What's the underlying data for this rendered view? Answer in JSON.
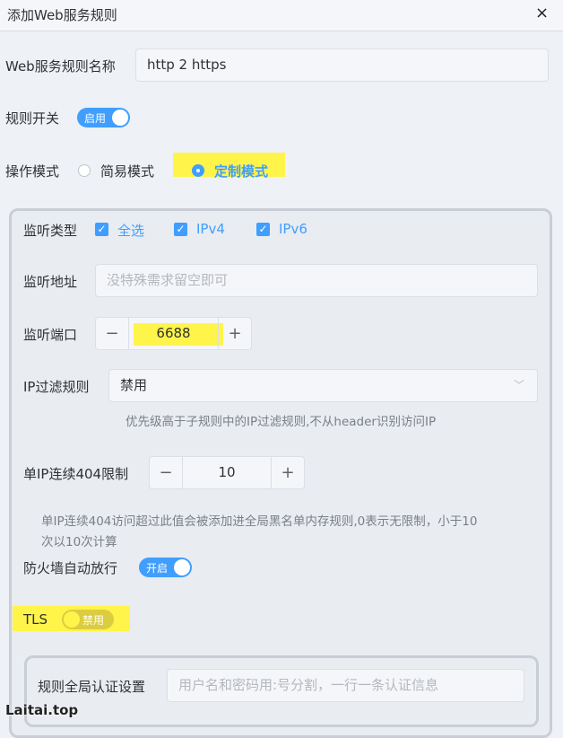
{
  "dialog": {
    "title": "添加Web服务规则",
    "close_icon": "×"
  },
  "rule_name": {
    "label": "Web服务规则名称",
    "value": "http 2 https"
  },
  "rule_switch": {
    "label": "规则开关",
    "state_text": "启用"
  },
  "operation_mode": {
    "label": "操作模式",
    "options": [
      {
        "label": "简易模式",
        "selected": false
      },
      {
        "label": "定制模式",
        "selected": true
      }
    ]
  },
  "listen_type": {
    "label": "监听类型",
    "options": [
      "全选",
      "IPv4",
      "IPv6"
    ]
  },
  "listen_address": {
    "label": "监听地址",
    "placeholder": "没特殊需求留空即可"
  },
  "listen_port": {
    "label": "监听端口",
    "value": "6688",
    "minus": "−",
    "plus": "+"
  },
  "ip_filter": {
    "label": "IP过滤规则",
    "value": "禁用",
    "hint": "优先级高于子规则中的IP过滤规则,不从header识别访问IP"
  },
  "limit_404": {
    "label": "单IP连续404限制",
    "value": "10",
    "minus": "−",
    "plus": "+",
    "hint_line1": "单IP连续404访问超过此值会被添加进全局黑名单内存规则,0表示无限制，小于10",
    "hint_line2": "次以10次计算"
  },
  "firewall": {
    "label": "防火墙自动放行",
    "state_text": "开启"
  },
  "tls": {
    "label": "TLS",
    "state_text": "禁用"
  },
  "global_auth": {
    "label": "规则全局认证设置",
    "placeholder": "用户名和密码用:号分割，一行一条认证信息"
  },
  "watermark": "Laitai.top",
  "colors": {
    "primary": "#409eff",
    "highlight": "#fff44a"
  }
}
